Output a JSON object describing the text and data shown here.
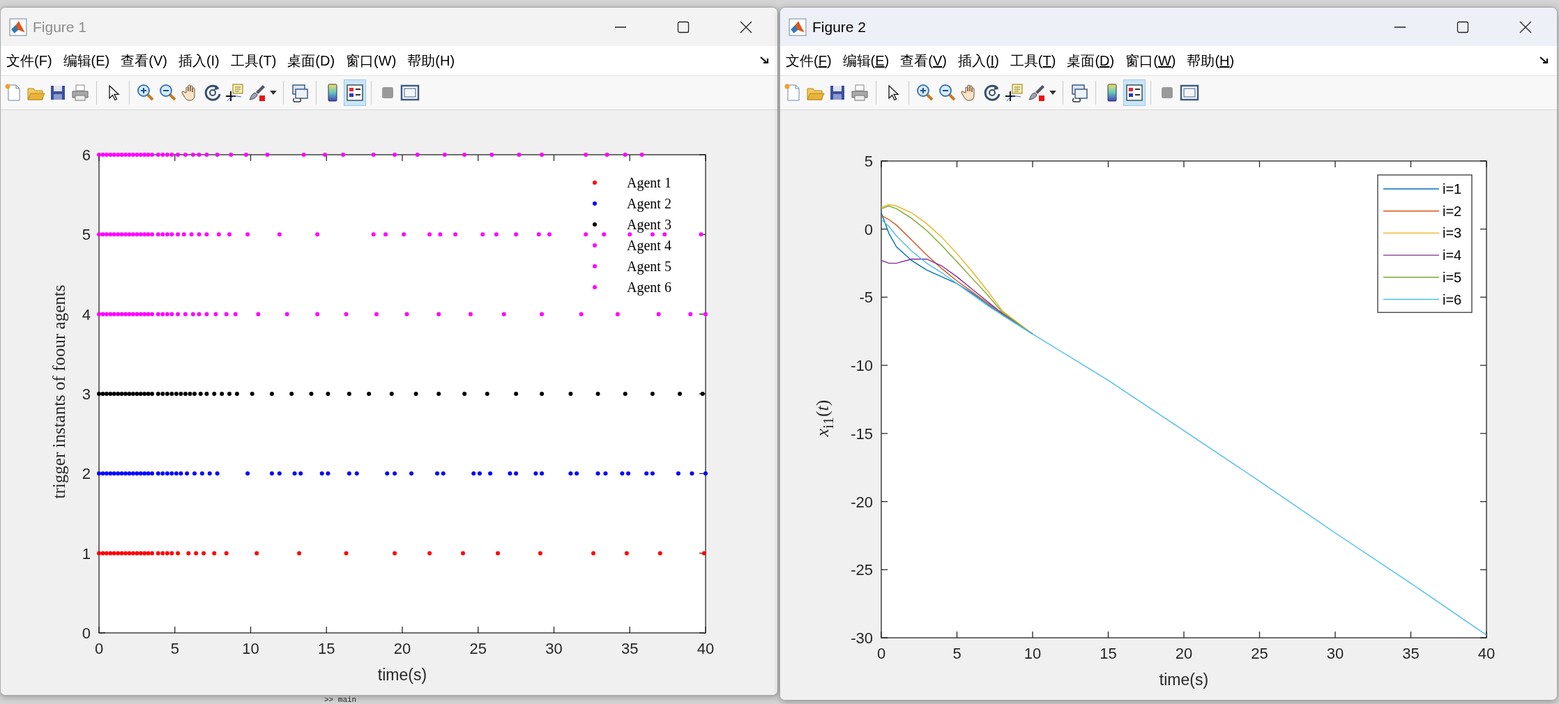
{
  "windows": [
    {
      "title": "Figure 1",
      "active": false,
      "menu": [
        "文件(F)",
        "编辑(E)",
        "查看(V)",
        "插入(I)",
        "工具(T)",
        "桌面(D)",
        "窗口(W)",
        "帮助(H)"
      ],
      "toolbar": [
        {
          "selected": false
        },
        {
          "selected": false
        },
        {
          "selected": false
        },
        {
          "selected": false
        },
        {
          "selected": false
        },
        {
          "selected": false
        },
        {
          "selected": false
        },
        {
          "selected": false
        },
        {
          "selected": false
        },
        {
          "selected": false
        },
        {
          "selected": false
        },
        {
          "selected": false
        },
        {
          "selected": false
        },
        {
          "selected": false
        },
        {
          "selected": true
        },
        {
          "selected": false
        },
        {
          "selected": false
        }
      ],
      "chart_data": {
        "type": "scatter",
        "xlabel": "time(s)",
        "ylabel": "trigger instants of foour agents",
        "xlim": [
          0,
          40
        ],
        "ylim": [
          0,
          6
        ],
        "xticks": [
          0,
          5,
          10,
          15,
          20,
          25,
          30,
          35,
          40
        ],
        "yticks": [
          0,
          1,
          2,
          3,
          4,
          5,
          6
        ],
        "legend": {
          "boxed": false
        },
        "series": [
          {
            "name": "Agent 1",
            "color": "#ff0000",
            "x": [
              0,
              0.25,
              0.5,
              0.75,
              1,
              1.25,
              1.5,
              1.75,
              2,
              2.25,
              2.5,
              2.75,
              3,
              3.25,
              3.5,
              3.9,
              4.2,
              4.5,
              4.8,
              5.2,
              5.9,
              6.4,
              6.9,
              7.6,
              8.4,
              10.4,
              13.2,
              16.3,
              19.5,
              21.8,
              24,
              26.3,
              29.1,
              32.6,
              34.8,
              37,
              39.9
            ],
            "values": [
              1,
              1,
              1,
              1,
              1,
              1,
              1,
              1,
              1,
              1,
              1,
              1,
              1,
              1,
              1,
              1,
              1,
              1,
              1,
              1,
              1,
              1,
              1,
              1,
              1,
              1,
              1,
              1,
              1,
              1,
              1,
              1,
              1,
              1,
              1,
              1,
              1
            ]
          },
          {
            "name": "Agent 2",
            "color": "#0000ff",
            "x": [
              0,
              0.25,
              0.5,
              0.75,
              1,
              1.25,
              1.5,
              1.75,
              2,
              2.25,
              2.5,
              2.75,
              3,
              3.25,
              3.5,
              3.9,
              4.2,
              4.5,
              4.8,
              5.1,
              5.4,
              5.8,
              6.3,
              6.8,
              7.3,
              7.8,
              9.8,
              11.4,
              11.9,
              12.9,
              13.3,
              14.7,
              15.1,
              16.5,
              17,
              19,
              19.5,
              20.6,
              22.3,
              22.7,
              24.7,
              25.1,
              25.8,
              27.1,
              27.5,
              28.8,
              29.2,
              31.1,
              31.5,
              32.9,
              33.4,
              34.5,
              34.9,
              36.1,
              36.5,
              38.2,
              39.1,
              40
            ],
            "values": [
              2,
              2,
              2,
              2,
              2,
              2,
              2,
              2,
              2,
              2,
              2,
              2,
              2,
              2,
              2,
              2,
              2,
              2,
              2,
              2,
              2,
              2,
              2,
              2,
              2,
              2,
              2,
              2,
              2,
              2,
              2,
              2,
              2,
              2,
              2,
              2,
              2,
              2,
              2,
              2,
              2,
              2,
              2,
              2,
              2,
              2,
              2,
              2,
              2,
              2,
              2,
              2,
              2,
              2,
              2,
              2,
              2,
              2
            ]
          },
          {
            "name": "Agent 3",
            "color": "#000000",
            "x": [
              0,
              0.25,
              0.5,
              0.75,
              1,
              1.25,
              1.5,
              1.75,
              2,
              2.25,
              2.5,
              2.75,
              3,
              3.25,
              3.5,
              3.9,
              4.2,
              4.5,
              4.8,
              5.1,
              5.4,
              5.7,
              6,
              6.3,
              6.7,
              7.1,
              7.6,
              8.1,
              8.6,
              9.1,
              10.1,
              11.4,
              12.7,
              14,
              15.1,
              16.5,
              17.8,
              19.3,
              20.9,
              22.4,
              24.1,
              25.6,
              27.5,
              29.2,
              31.1,
              32.9,
              34.7,
              36.5,
              38.3,
              39.8
            ],
            "values": [
              3,
              3,
              3,
              3,
              3,
              3,
              3,
              3,
              3,
              3,
              3,
              3,
              3,
              3,
              3,
              3,
              3,
              3,
              3,
              3,
              3,
              3,
              3,
              3,
              3,
              3,
              3,
              3,
              3,
              3,
              3,
              3,
              3,
              3,
              3,
              3,
              3,
              3,
              3,
              3,
              3,
              3,
              3,
              3,
              3,
              3,
              3,
              3,
              3,
              3
            ]
          },
          {
            "name": "Agent 4",
            "color": "#ff00ff",
            "x": [
              0,
              0.25,
              0.5,
              0.75,
              1,
              1.25,
              1.5,
              1.75,
              2,
              2.25,
              2.5,
              2.75,
              3,
              3.25,
              3.5,
              3.9,
              4.2,
              4.5,
              4.8,
              5.2,
              5.7,
              6.2,
              6.6,
              7.1,
              7.7,
              8.4,
              9,
              10.5,
              12.4,
              14.4,
              16.3,
              18.3,
              20.3,
              22.4,
              24.5,
              26.7,
              29.2,
              31.8,
              34.2,
              36.9,
              39,
              40
            ],
            "values": [
              4,
              4,
              4,
              4,
              4,
              4,
              4,
              4,
              4,
              4,
              4,
              4,
              4,
              4,
              4,
              4,
              4,
              4,
              4,
              4,
              4,
              4,
              4,
              4,
              4,
              4,
              4,
              4,
              4,
              4,
              4,
              4,
              4,
              4,
              4,
              4,
              4,
              4,
              4,
              4,
              4,
              4
            ]
          },
          {
            "name": "Agent 5",
            "color": "#ff00ff",
            "x": [
              0,
              0.25,
              0.5,
              0.75,
              1,
              1.25,
              1.5,
              1.75,
              2,
              2.25,
              2.5,
              2.75,
              3,
              3.25,
              3.5,
              3.9,
              4.2,
              4.5,
              4.8,
              5.2,
              5.6,
              6.1,
              6.6,
              7.1,
              7.9,
              8.6,
              9.8,
              11.9,
              14.4,
              18.1,
              18.9,
              20.1,
              21.8,
              22.5,
              23.5,
              25.3,
              26.2,
              27.5,
              29,
              29.7,
              32.1,
              33.3,
              35,
              36.5,
              37.3,
              39.7
            ],
            "values": [
              5,
              5,
              5,
              5,
              5,
              5,
              5,
              5,
              5,
              5,
              5,
              5,
              5,
              5,
              5,
              5,
              5,
              5,
              5,
              5,
              5,
              5,
              5,
              5,
              5,
              5,
              5,
              5,
              5,
              5,
              5,
              5,
              5,
              5,
              5,
              5,
              5,
              5,
              5,
              5,
              5,
              5,
              5,
              5,
              5,
              5
            ]
          },
          {
            "name": "Agent 6",
            "color": "#ff00ff",
            "x": [
              0,
              0.25,
              0.5,
              0.75,
              1,
              1.25,
              1.5,
              1.75,
              2,
              2.25,
              2.5,
              2.75,
              3,
              3.25,
              3.5,
              3.9,
              4.2,
              4.5,
              4.8,
              5.2,
              5.7,
              6.2,
              6.6,
              7.1,
              7.8,
              8.7,
              9.7,
              11.1,
              13.5,
              14.9,
              16.1,
              18.1,
              19.5,
              21,
              22.8,
              24.1,
              25.9,
              27.7,
              29.2,
              32.1,
              33.5,
              34.7,
              35.8
            ],
            "values": [
              6,
              6,
              6,
              6,
              6,
              6,
              6,
              6,
              6,
              6,
              6,
              6,
              6,
              6,
              6,
              6,
              6,
              6,
              6,
              6,
              6,
              6,
              6,
              6,
              6,
              6,
              6,
              6,
              6,
              6,
              6,
              6,
              6,
              6,
              6,
              6,
              6,
              6,
              6,
              6,
              6,
              6,
              6
            ]
          }
        ]
      }
    },
    {
      "title": "Figure 2",
      "active": true,
      "menu": [
        "文件(F)",
        "编辑(E)",
        "查看(V)",
        "插入(I)",
        "工具(T)",
        "桌面(D)",
        "窗口(W)",
        "帮助(H)"
      ],
      "toolbar": [
        {
          "selected": false
        },
        {
          "selected": false
        },
        {
          "selected": false
        },
        {
          "selected": false
        },
        {
          "selected": false
        },
        {
          "selected": false
        },
        {
          "selected": false
        },
        {
          "selected": false
        },
        {
          "selected": false
        },
        {
          "selected": false
        },
        {
          "selected": false
        },
        {
          "selected": false
        },
        {
          "selected": false
        },
        {
          "selected": false
        },
        {
          "selected": true
        },
        {
          "selected": false
        },
        {
          "selected": false
        }
      ],
      "chart_data": {
        "type": "line",
        "xlabel": "time(s)",
        "ylabel": "*x*$_{i1}$(*t*)",
        "x": [
          0,
          0.5,
          1,
          2,
          3,
          4,
          5,
          6,
          7,
          8,
          10,
          15,
          20,
          25,
          30,
          35,
          40
        ],
        "xlim": [
          0,
          40
        ],
        "ylim": [
          -30,
          5
        ],
        "xticks": [
          0,
          5,
          10,
          15,
          20,
          25,
          30,
          35,
          40
        ],
        "yticks": [
          -30,
          -25,
          -20,
          -15,
          -10,
          -5,
          0,
          5
        ],
        "legend": {
          "boxed": true
        },
        "series": [
          {
            "name": "i=1",
            "color": "#0072bd",
            "values": [
              1.2,
              -0.3,
              -1.3,
              -2.3,
              -3,
              -3.5,
              -4,
              -4.7,
              -5.5,
              -6.3,
              -7.7,
              null,
              null,
              null,
              null,
              null,
              null
            ]
          },
          {
            "name": "i=2",
            "color": "#d95319",
            "values": [
              1,
              0.7,
              0.3,
              -0.8,
              -1.9,
              -2.9,
              -3.8,
              -4.6,
              -5.4,
              -6.2,
              -7.7,
              null,
              null,
              null,
              null,
              null,
              null
            ]
          },
          {
            "name": "i=3",
            "color": "#edb120",
            "values": [
              1.6,
              1.8,
              1.7,
              1.2,
              0.4,
              -0.6,
              -1.8,
              -3.1,
              -4.5,
              -6,
              -7.7,
              null,
              null,
              null,
              null,
              null,
              null
            ]
          },
          {
            "name": "i=4",
            "color": "#7e2f8e",
            "values": [
              -2.3,
              -2.5,
              -2.5,
              -2.2,
              -2.2,
              -2.7,
              -3.5,
              -4.4,
              -5.3,
              -6.2,
              -7.7,
              null,
              null,
              null,
              null,
              null,
              null
            ]
          },
          {
            "name": "i=5",
            "color": "#77ac30",
            "values": [
              1.5,
              1.7,
              1.5,
              0.8,
              -0.1,
              -1.2,
              -2.4,
              -3.6,
              -4.8,
              -6.1,
              -7.7,
              null,
              null,
              null,
              null,
              null,
              null
            ]
          },
          {
            "name": "i=6",
            "color": "#4dbeee",
            "values": [
              0.7,
              0.2,
              -0.5,
              -1.6,
              -2.5,
              -3.2,
              -4,
              -4.8,
              -5.6,
              -6.3,
              -7.7,
              -11.1,
              -14.8,
              -18.5,
              -22.3,
              -26,
              -29.8
            ]
          }
        ]
      }
    }
  ],
  "command_line": ">> main"
}
